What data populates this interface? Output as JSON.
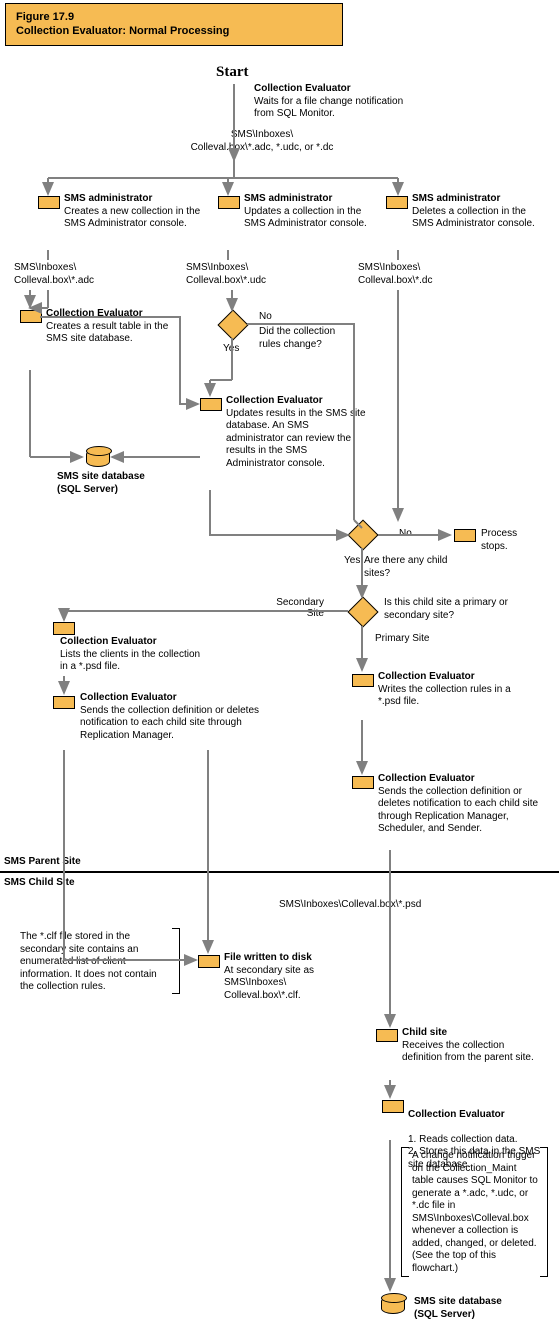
{
  "figure": {
    "number": "Figure 17.9",
    "title": "Collection Evaluator: Normal Processing"
  },
  "start": "Start",
  "nodes": {
    "wait": {
      "title": "Collection Evaluator",
      "body": "Waits for a file change notification from SQL Monitor."
    },
    "wait_path": "SMS\\Inboxes\\\nColleval.box\\*.adc, *.udc, or *.dc",
    "admin_create": {
      "title": "SMS administrator",
      "body": "Creates a new collection in the SMS Administrator console."
    },
    "admin_update": {
      "title": "SMS administrator",
      "body": "Updates a collection in the SMS Administrator console."
    },
    "admin_delete": {
      "title": "SMS administrator",
      "body": "Deletes a collection in the SMS Administrator console."
    },
    "path_adc": "SMS\\Inboxes\\\nColleval.box\\*.adc",
    "path_udc": "SMS\\Inboxes\\\nColleval.box\\*.udc",
    "path_dc": "SMS\\Inboxes\\\nColleval.box\\*.dc",
    "create_result": {
      "title": "Collection Evaluator",
      "body": "Creates a result table in the SMS site database."
    },
    "rules_q": "Did the collection rules change?",
    "yes": "Yes",
    "no": "No",
    "update_results": {
      "title": "Collection Evaluator",
      "body": "Updates results in the SMS site database. An SMS administrator can review the results in the SMS Administrator console."
    },
    "db1": "SMS site database\n(SQL Server)",
    "child_q": "Are there any child sites?",
    "process_stops": "Process stops.",
    "site_type_q": "Is this child site a primary or secondary site?",
    "secondary": "Secondary Site",
    "primary": "Primary Site",
    "list_clients": {
      "title": "Collection Evaluator",
      "body": "Lists the clients in the collection in a *.psd file."
    },
    "send_def_or_del": {
      "title": "Collection Evaluator",
      "body": "Sends the collection definition or deletes notification to each child site through Replication Manager."
    },
    "write_rules": {
      "title": "Collection Evaluator",
      "body": "Writes the collection rules in a *.psd file."
    },
    "send_def_full": {
      "title": "Collection Evaluator",
      "body": "Sends the collection definition or deletes notification to each child site through Replication Manager, Scheduler, and Sender."
    },
    "parent_label": "SMS Parent Site",
    "child_label": "SMS Child Site",
    "psd_path": "SMS\\Inboxes\\Colleval.box\\*.psd",
    "clf_note": "The *.clf file stored in the secondary site contains an enumerated list of client information. It does not contain the collection rules.",
    "file_written": {
      "title": "File written to disk",
      "body": "At secondary site as SMS\\Inboxes\\\nColleval.box\\*.clf."
    },
    "child_site": {
      "title": "Child site",
      "body": "Receives the collection definition from the parent site."
    },
    "read_store": {
      "title": "Collection Evaluator",
      "body": "1. Reads collection data.\n2. Stores this data in the SMS site database."
    },
    "trigger_note": "A change notification trigger on the Collection_Maint table causes SQL Monitor to generate a *.adc, *.udc, or *.dc file in SMS\\Inboxes\\Colleval.box whenever a collection is added, changed, or deleted. (See the top of this flowchart.)",
    "db2": "SMS site database\n(SQL Server)"
  }
}
